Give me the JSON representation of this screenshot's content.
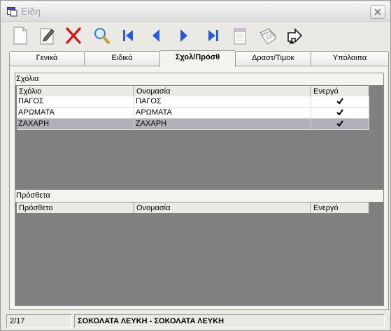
{
  "window": {
    "title": "Είδη"
  },
  "toolbar": {
    "buttons": [
      {
        "name": "new-icon"
      },
      {
        "name": "edit-icon"
      },
      {
        "name": "delete-icon"
      },
      {
        "name": "search-icon"
      },
      {
        "name": "first-record-icon"
      },
      {
        "name": "previous-record-icon"
      },
      {
        "name": "next-record-icon"
      },
      {
        "name": "last-record-icon"
      },
      {
        "name": "notepad-icon"
      },
      {
        "name": "documents-icon"
      },
      {
        "name": "exit-icon"
      }
    ]
  },
  "tabs": [
    {
      "label": "Γενικά",
      "active": false
    },
    {
      "label": "Ειδικά",
      "active": false
    },
    {
      "label": "Σχολ/Πρόσθ",
      "active": true
    },
    {
      "label": "Δραστ/Τιμοκ",
      "active": false
    },
    {
      "label": "Υπόλοιπα",
      "active": false
    }
  ],
  "comments": {
    "label": "Σχόλια",
    "columns": [
      "Σχόλιο",
      "Ονομασία",
      "Ενεργό"
    ],
    "rows": [
      {
        "code": "ΠΑΓΟΣ",
        "name": "ΠΑΓΟΣ",
        "active": true,
        "selected": false
      },
      {
        "code": "ΑΡΩΜΑΤΑ",
        "name": "ΑΡΩΜΑΤΑ",
        "active": true,
        "selected": false
      },
      {
        "code": "ΖΑΧΑΡΗ",
        "name": "ΖΑΧΑΡΗ",
        "active": true,
        "selected": true
      }
    ]
  },
  "extras": {
    "label": "Πρόσθετα",
    "columns": [
      "Πρόσθετο",
      "Ονομασία",
      "Ενεργό"
    ],
    "rows": []
  },
  "status": {
    "position": "2/17",
    "item": "ΣΟΚΟΛΑΤΑ ΛΕΥΚΗ - ΣΟΚΟΛΑΤΑ ΛΕΥΚΗ"
  },
  "colors": {
    "grid_background": "#808080",
    "selected_row": "#b0b0b8",
    "nav_arrow": "#2a5ad8",
    "delete_red": "#d01818"
  }
}
